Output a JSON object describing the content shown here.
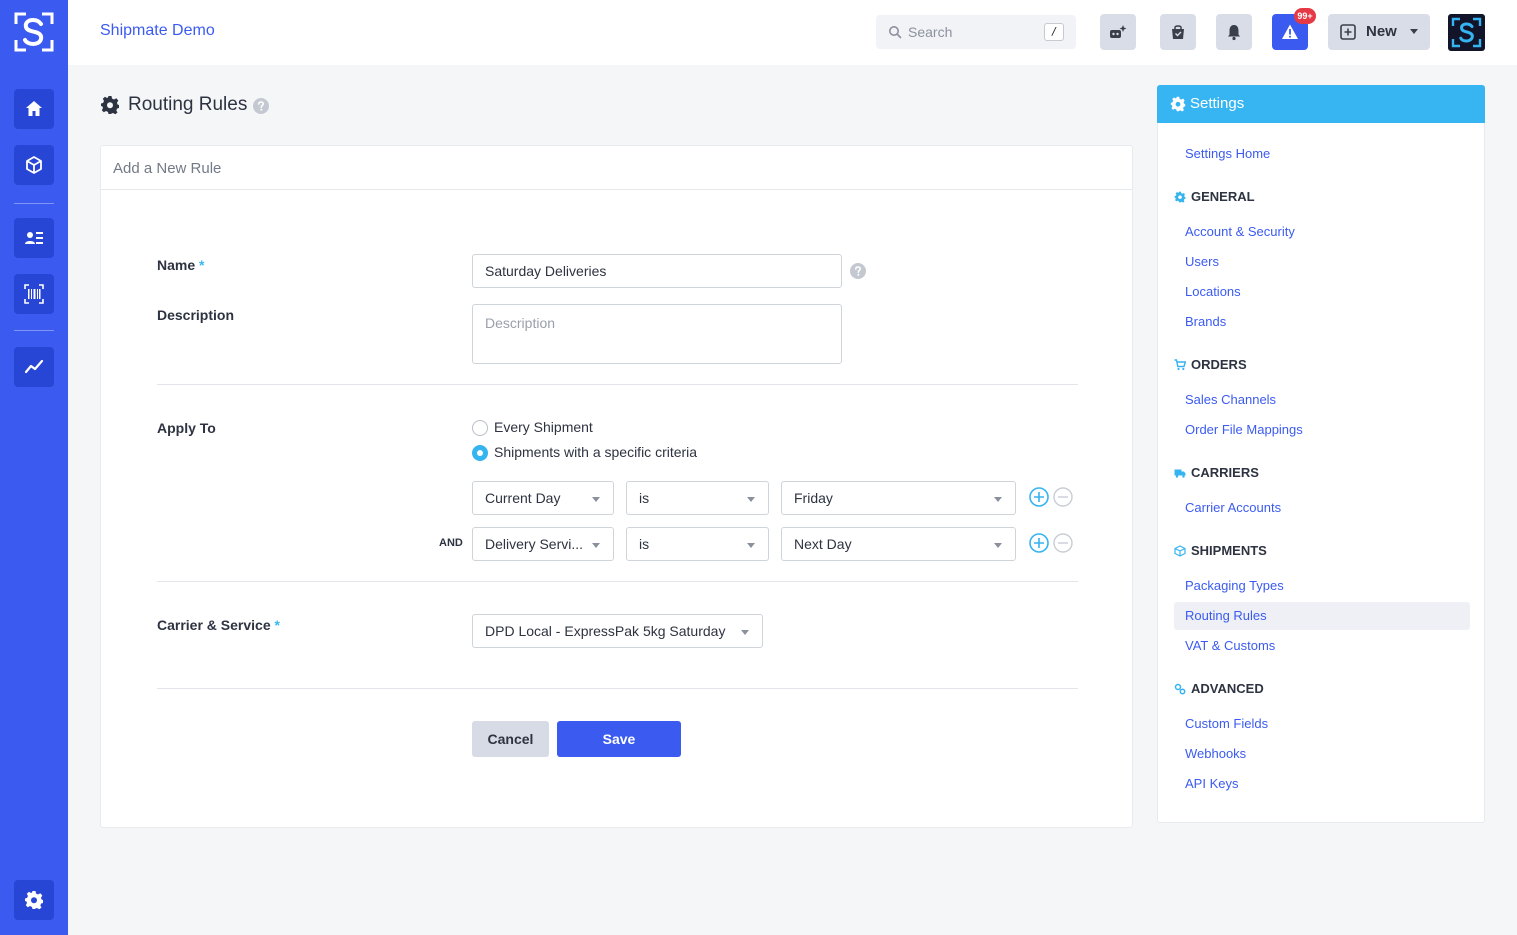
{
  "app": {
    "title": "Shipmate Demo"
  },
  "search": {
    "placeholder": "Search",
    "shortcut": "/"
  },
  "topbar": {
    "alerts_badge": "99+",
    "new_label": "New"
  },
  "page": {
    "title": "Routing Rules"
  },
  "form": {
    "header": "Add a New Rule",
    "name_label": "Name",
    "required_mark": "*",
    "name_value": "Saturday Deliveries",
    "description_label": "Description",
    "description_placeholder": "Description",
    "apply_to_label": "Apply To",
    "apply_options": [
      {
        "label": "Every Shipment",
        "selected": false
      },
      {
        "label": "Shipments with a specific criteria",
        "selected": true
      }
    ],
    "criteria": [
      {
        "joiner": "",
        "field": "Current Day",
        "operator": "is",
        "value": "Friday"
      },
      {
        "joiner": "AND",
        "field": "Delivery Servi...",
        "operator": "is",
        "value": "Next Day"
      }
    ],
    "carrier_label": "Carrier & Service",
    "carrier_value": "DPD Local - ExpressPak 5kg Saturday",
    "cancel_label": "Cancel",
    "save_label": "Save"
  },
  "settings": {
    "title": "Settings",
    "home": "Settings Home",
    "sections": [
      {
        "title": "GENERAL",
        "icon": "gear-icon",
        "items": [
          "Account & Security",
          "Users",
          "Locations",
          "Brands"
        ]
      },
      {
        "title": "ORDERS",
        "icon": "cart-icon",
        "items": [
          "Sales Channels",
          "Order File Mappings"
        ]
      },
      {
        "title": "CARRIERS",
        "icon": "truck-icon",
        "items": [
          "Carrier Accounts"
        ]
      },
      {
        "title": "SHIPMENTS",
        "icon": "box-icon",
        "items": [
          "Packaging Types",
          "Routing Rules",
          "VAT & Customs"
        ]
      },
      {
        "title": "ADVANCED",
        "icon": "cogs-icon",
        "items": [
          "Custom Fields",
          "Webhooks",
          "API Keys"
        ]
      }
    ],
    "active_item": "Routing Rules"
  },
  "colors": {
    "brand": "#3b5bf0",
    "accent": "#37b5f2",
    "alert": "#e53945"
  }
}
